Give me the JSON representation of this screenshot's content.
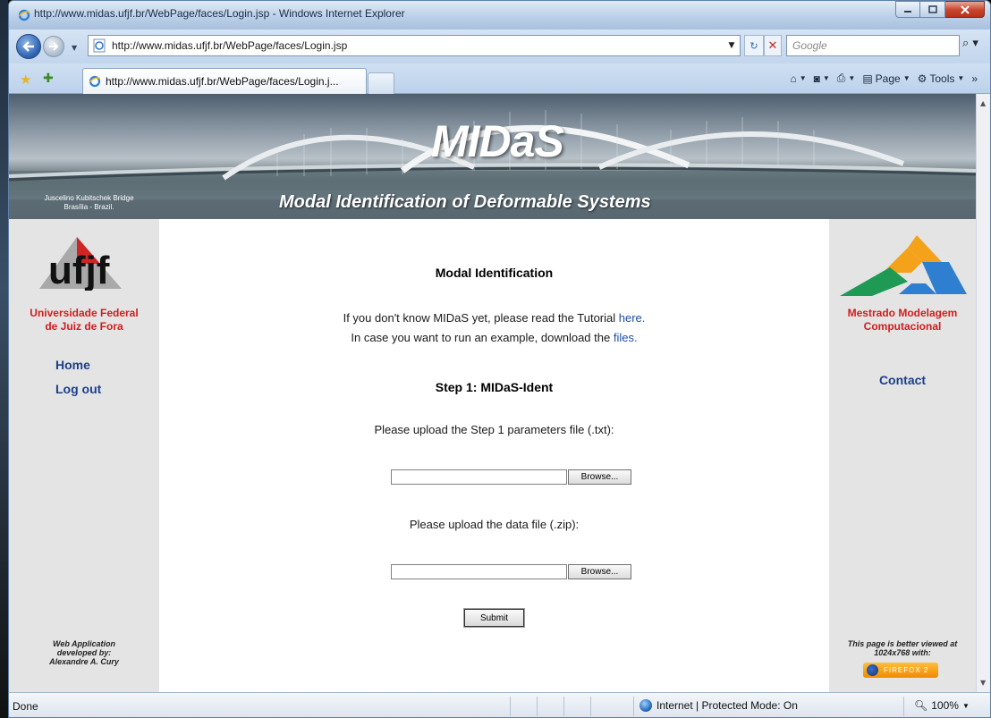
{
  "window": {
    "title": "http://www.midas.ufjf.br/WebPage/faces/Login.jsp - Windows Internet Explorer"
  },
  "address": {
    "url": "http://www.midas.ufjf.br/WebPage/faces/Login.jsp",
    "search_placeholder": "Google"
  },
  "tab": {
    "label": "http://www.midas.ufjf.br/WebPage/faces/Login.j..."
  },
  "commandbar": {
    "page_label": "Page",
    "tools_label": "Tools",
    "more": "»"
  },
  "banner": {
    "brand": "MIDaS",
    "tagline": "Modal Identification of Deformable Systems",
    "caption_line1": "Juscelino Kubitschek Bridge",
    "caption_line2": "Brasília - Brazil."
  },
  "left": {
    "logo_text": "ufjf",
    "univ_line1": "Universidade Federal",
    "univ_line2": "de Juiz de Fora",
    "nav_home": "Home",
    "nav_logout": "Log out",
    "credit_line1": "Web Application",
    "credit_line2": "developed by:",
    "credit_line3": "Alexandre A. Cury"
  },
  "right": {
    "prog_line1": "Mestrado Modelagem",
    "prog_line2": "Computacional",
    "contact": "Contact",
    "note_line1": "This page is better viewed at",
    "note_line2": "1024x768 with:",
    "badge": "FIREFOX 2"
  },
  "main": {
    "heading": "Modal Identification",
    "intro1_text": "If you don't know MIDaS yet, please read the Tutorial ",
    "intro1_link": "here.",
    "intro2_text": "In case you want to run an example, download the ",
    "intro2_link": "files.",
    "step_heading": "Step 1: MIDaS-Ident",
    "upload1_label": "Please upload the Step 1 parameters file (.txt):",
    "upload2_label": "Please upload the data file (.zip):",
    "browse_label": "Browse...",
    "submit_label": "Submit"
  },
  "status": {
    "text": "Done",
    "zone": "Internet | Protected Mode: On",
    "zoom": "100%"
  },
  "colors": {
    "link": "#1e4ea8",
    "nav": "#1b3f8c",
    "accent_red": "#d11d1d",
    "sidebar_bg": "#e4e4e4"
  }
}
